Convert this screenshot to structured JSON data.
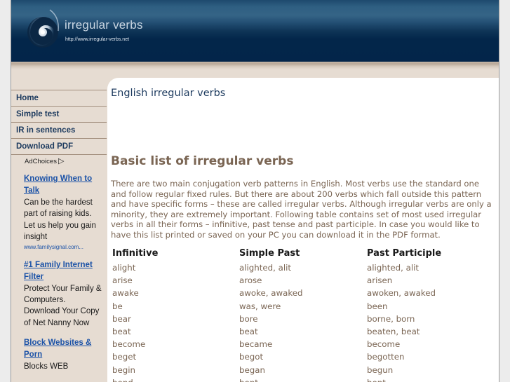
{
  "header": {
    "site_title": "irregular verbs",
    "site_url": "http://www.irregular-verbs.net",
    "logo_icon": "spiral-logo-icon"
  },
  "nav": {
    "items": [
      {
        "label": "Home"
      },
      {
        "label": "Simple test"
      },
      {
        "label": "IR in sentences"
      },
      {
        "label": "Download PDF"
      }
    ]
  },
  "ads": {
    "ad_choices_label": "AdChoices",
    "ad_choices_icon": "▷",
    "items": [
      {
        "title": "Knowing When to Talk",
        "body": "Can be the hardest part of raising kids. Let us help you gain insight",
        "url": "www.familysignal.com..."
      },
      {
        "title": "#1 Family Internet Filter",
        "body": "Protect Your Family & Computers. Download Your Copy of Net Nanny Now",
        "url": ""
      },
      {
        "title": "Block Websites & Porn",
        "body": "Blocks WEB",
        "url": ""
      }
    ]
  },
  "main": {
    "title": "English irregular verbs",
    "section_title": "Basic list of irregular verbs",
    "intro": "There are two main conjugation verb patterns in English. Most verbs use the standard one and follow regular fixed rules. But there are about 200 verbs which fall outside this pattern and have specific forms – these are called irregular verbs. Although irregular verbs are only a minority, they are extremely important. Following table contains set of most used irregular verbs in all their forms – infinitive, past tense and past participle. In case you would like to have this list printed or saved on your PC you can download it in the PDF format.",
    "table": {
      "headers": [
        "Infinitive",
        "Simple Past",
        "Past Participle"
      ],
      "rows": [
        [
          "alight",
          "alighted, alit",
          "alighted, alit"
        ],
        [
          "arise",
          "arose",
          "arisen"
        ],
        [
          "awake",
          "awoke, awaked",
          "awoken, awaked"
        ],
        [
          "be",
          "was, were",
          "been"
        ],
        [
          "bear",
          "bore",
          "borne, born"
        ],
        [
          "beat",
          "beat",
          "beaten, beat"
        ],
        [
          "become",
          "became",
          "become"
        ],
        [
          "beget",
          "begot",
          "begotten"
        ],
        [
          "begin",
          "began",
          "begun"
        ],
        [
          "bend",
          "bent",
          "bent"
        ]
      ]
    }
  },
  "colors": {
    "header_dark": "#03254a",
    "sidebar_bg": "#e6dcd2",
    "nav_text": "#1c3a5e",
    "ad_link": "#1b52a7",
    "body_text": "#7a6553"
  }
}
